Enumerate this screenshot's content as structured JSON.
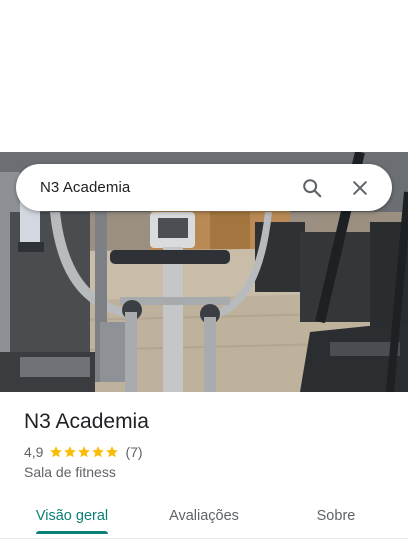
{
  "search": {
    "query": "N3 Academia"
  },
  "place": {
    "name": "N3 Academia",
    "rating": "4,9",
    "stars": 5,
    "review_count": "(7)",
    "category": "Sala de fitness"
  },
  "tabs": [
    {
      "label": "Visão geral",
      "active": true
    },
    {
      "label": "Avaliações",
      "active": false
    },
    {
      "label": "Sobre",
      "active": false
    }
  ],
  "colors": {
    "accent": "#0b8074",
    "star": "#fbbc04",
    "text_primary": "#202124",
    "text_secondary": "#5f6368"
  },
  "icons": {
    "search": "search-icon",
    "close": "close-icon",
    "star": "star-icon"
  }
}
